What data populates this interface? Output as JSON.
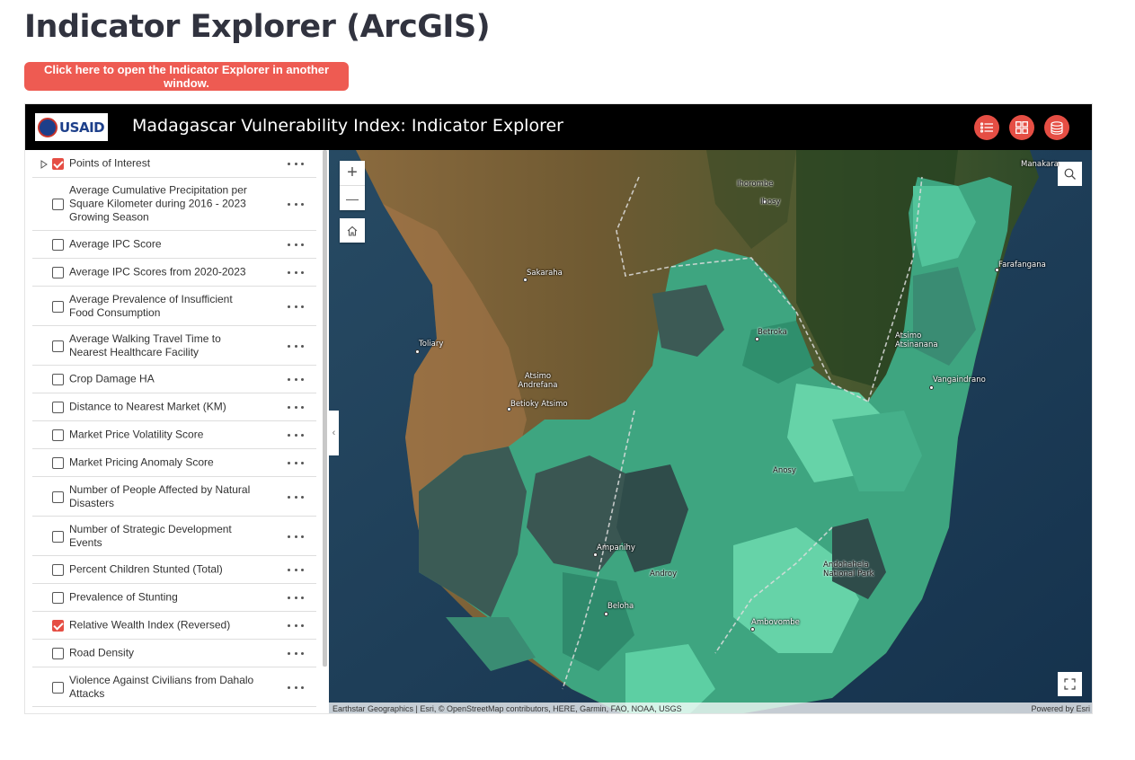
{
  "page": {
    "title": "Indicator Explorer (ArcGIS)",
    "open_button": "Click here to open the Indicator Explorer in another window."
  },
  "app": {
    "logo_text": "USAID",
    "title": "Madagascar Vulnerability Index: Indicator Explorer",
    "header_buttons": [
      "list-icon",
      "grid-icon",
      "database-icon"
    ],
    "accent_color": "#e54e44"
  },
  "layers": [
    {
      "label": "Points of Interest",
      "checked": true,
      "expandable": true
    },
    {
      "label": "Average Cumulative Precipitation per Square Kilometer during 2016 - 2023 Growing Season",
      "checked": false
    },
    {
      "label": "Average IPC Score",
      "checked": false
    },
    {
      "label": "Average IPC Scores from 2020-2023",
      "checked": false
    },
    {
      "label": "Average Prevalence of Insufficient Food Consumption",
      "checked": false
    },
    {
      "label": "Average Walking Travel Time to Nearest Healthcare Facility",
      "checked": false
    },
    {
      "label": "Crop Damage HA",
      "checked": false
    },
    {
      "label": "Distance to Nearest Market (KM)",
      "checked": false
    },
    {
      "label": "Market Price Volatility Score",
      "checked": false
    },
    {
      "label": "Market Pricing Anomaly Score",
      "checked": false
    },
    {
      "label": "Number of People Affected by Natural Disasters",
      "checked": false
    },
    {
      "label": "Number of Strategic Development Events",
      "checked": false
    },
    {
      "label": "Percent Children Stunted (Total)",
      "checked": false
    },
    {
      "label": "Prevalence of Stunting",
      "checked": false
    },
    {
      "label": "Relative Wealth Index (Reversed)",
      "checked": true
    },
    {
      "label": "Road Density",
      "checked": false
    },
    {
      "label": "Violence Against Civilians from Dahalo Attacks",
      "checked": false
    }
  ],
  "map": {
    "places": [
      "Manakara",
      "Ihorombe",
      "Ihosy",
      "Sakaraha",
      "Farafangana",
      "Betroka",
      "Toliary",
      "Atsimo Atsinanana",
      "Vangaindrano",
      "Atsimo Andrefana",
      "Betioky Atsimo",
      "Anosy",
      "Ampanihy",
      "Andohahela National Park",
      "Androy",
      "Beloha",
      "Ambovombe"
    ],
    "attribution": "Earthstar Geographics | Esri, © OpenStreetMap contributors, HERE, Garmin, FAO, NOAA, USGS",
    "powered_by": "Powered by Esri",
    "zoom_in": "+",
    "zoom_out": "—"
  }
}
